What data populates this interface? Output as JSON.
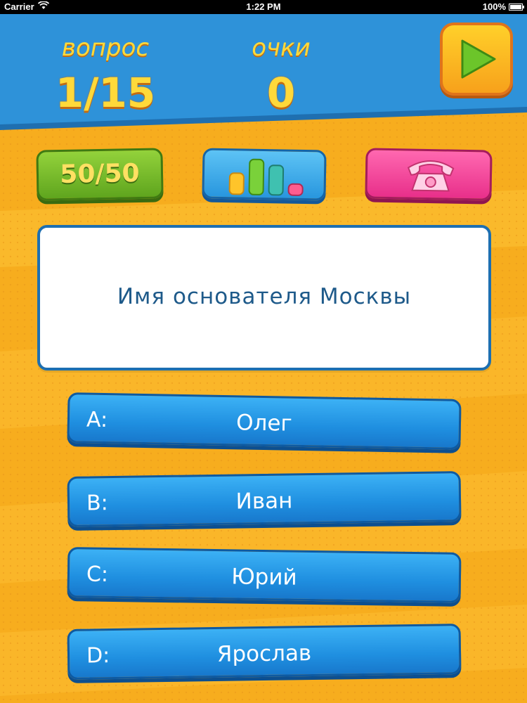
{
  "status_bar": {
    "carrier": "Carrier",
    "time": "1:22 PM",
    "battery": "100%"
  },
  "header": {
    "question_label": "вопрос",
    "question_value": "1/15",
    "score_label": "очки",
    "score_value": "0",
    "play_icon": "play-icon"
  },
  "lifelines": {
    "fifty_fifty_label": "50/50",
    "audience_icon": "audience-chart-icon",
    "phone_icon": "phone-icon"
  },
  "question": {
    "text": "Имя основателя Москвы"
  },
  "answers": [
    {
      "letter": "A:",
      "text": "Олег"
    },
    {
      "letter": "B:",
      "text": "Иван"
    },
    {
      "letter": "C:",
      "text": "Юрий"
    },
    {
      "letter": "D:",
      "text": "Ярослав"
    }
  ],
  "colors": {
    "background": "#f7ad1e",
    "header": "#2a8fd8",
    "accent_yellow": "#ffd93a",
    "answer_blue": "#1f8fe0",
    "fifty_green": "#6fb829",
    "phone_pink": "#f0439a"
  }
}
